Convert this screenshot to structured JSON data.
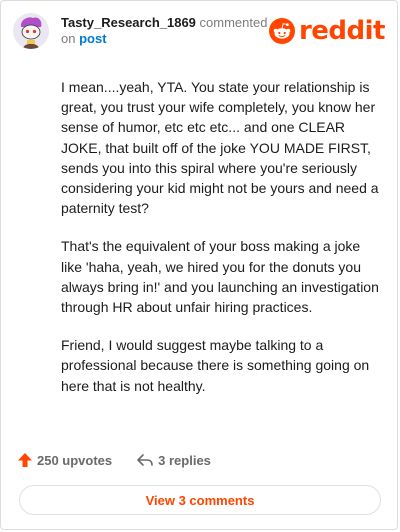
{
  "header": {
    "username": "Tasty_Research_1869",
    "action": "commented",
    "on_text": "on",
    "post_link": "post",
    "logo_text": "reddit"
  },
  "comment": {
    "paragraphs": [
      "I mean....yeah, YTA. You state your relationship is great, you trust your wife completely, you know her sense of humor, etc etc etc... and one CLEAR JOKE, that built off of the joke YOU MADE FIRST, sends you into this spiral where you're seriously considering your kid might not be yours and need a paternity test?",
      "That's the equivalent of your boss making a joke like 'haha, yeah, we hired you for the donuts you always bring in!' and you launching an investigation through HR about unfair hiring practices.",
      "Friend, I would suggest maybe talking to a professional because there is something going on here that is not healthy."
    ]
  },
  "stats": {
    "upvotes": "250 upvotes",
    "replies": "3 replies"
  },
  "footer": {
    "view_button": "View 3 comments"
  },
  "colors": {
    "brand": "#ff4500",
    "link": "#0079d3"
  },
  "icons": {
    "upvote": "upvote-arrow-icon",
    "reply": "reply-arrow-icon",
    "logo": "reddit-snoo-icon"
  }
}
